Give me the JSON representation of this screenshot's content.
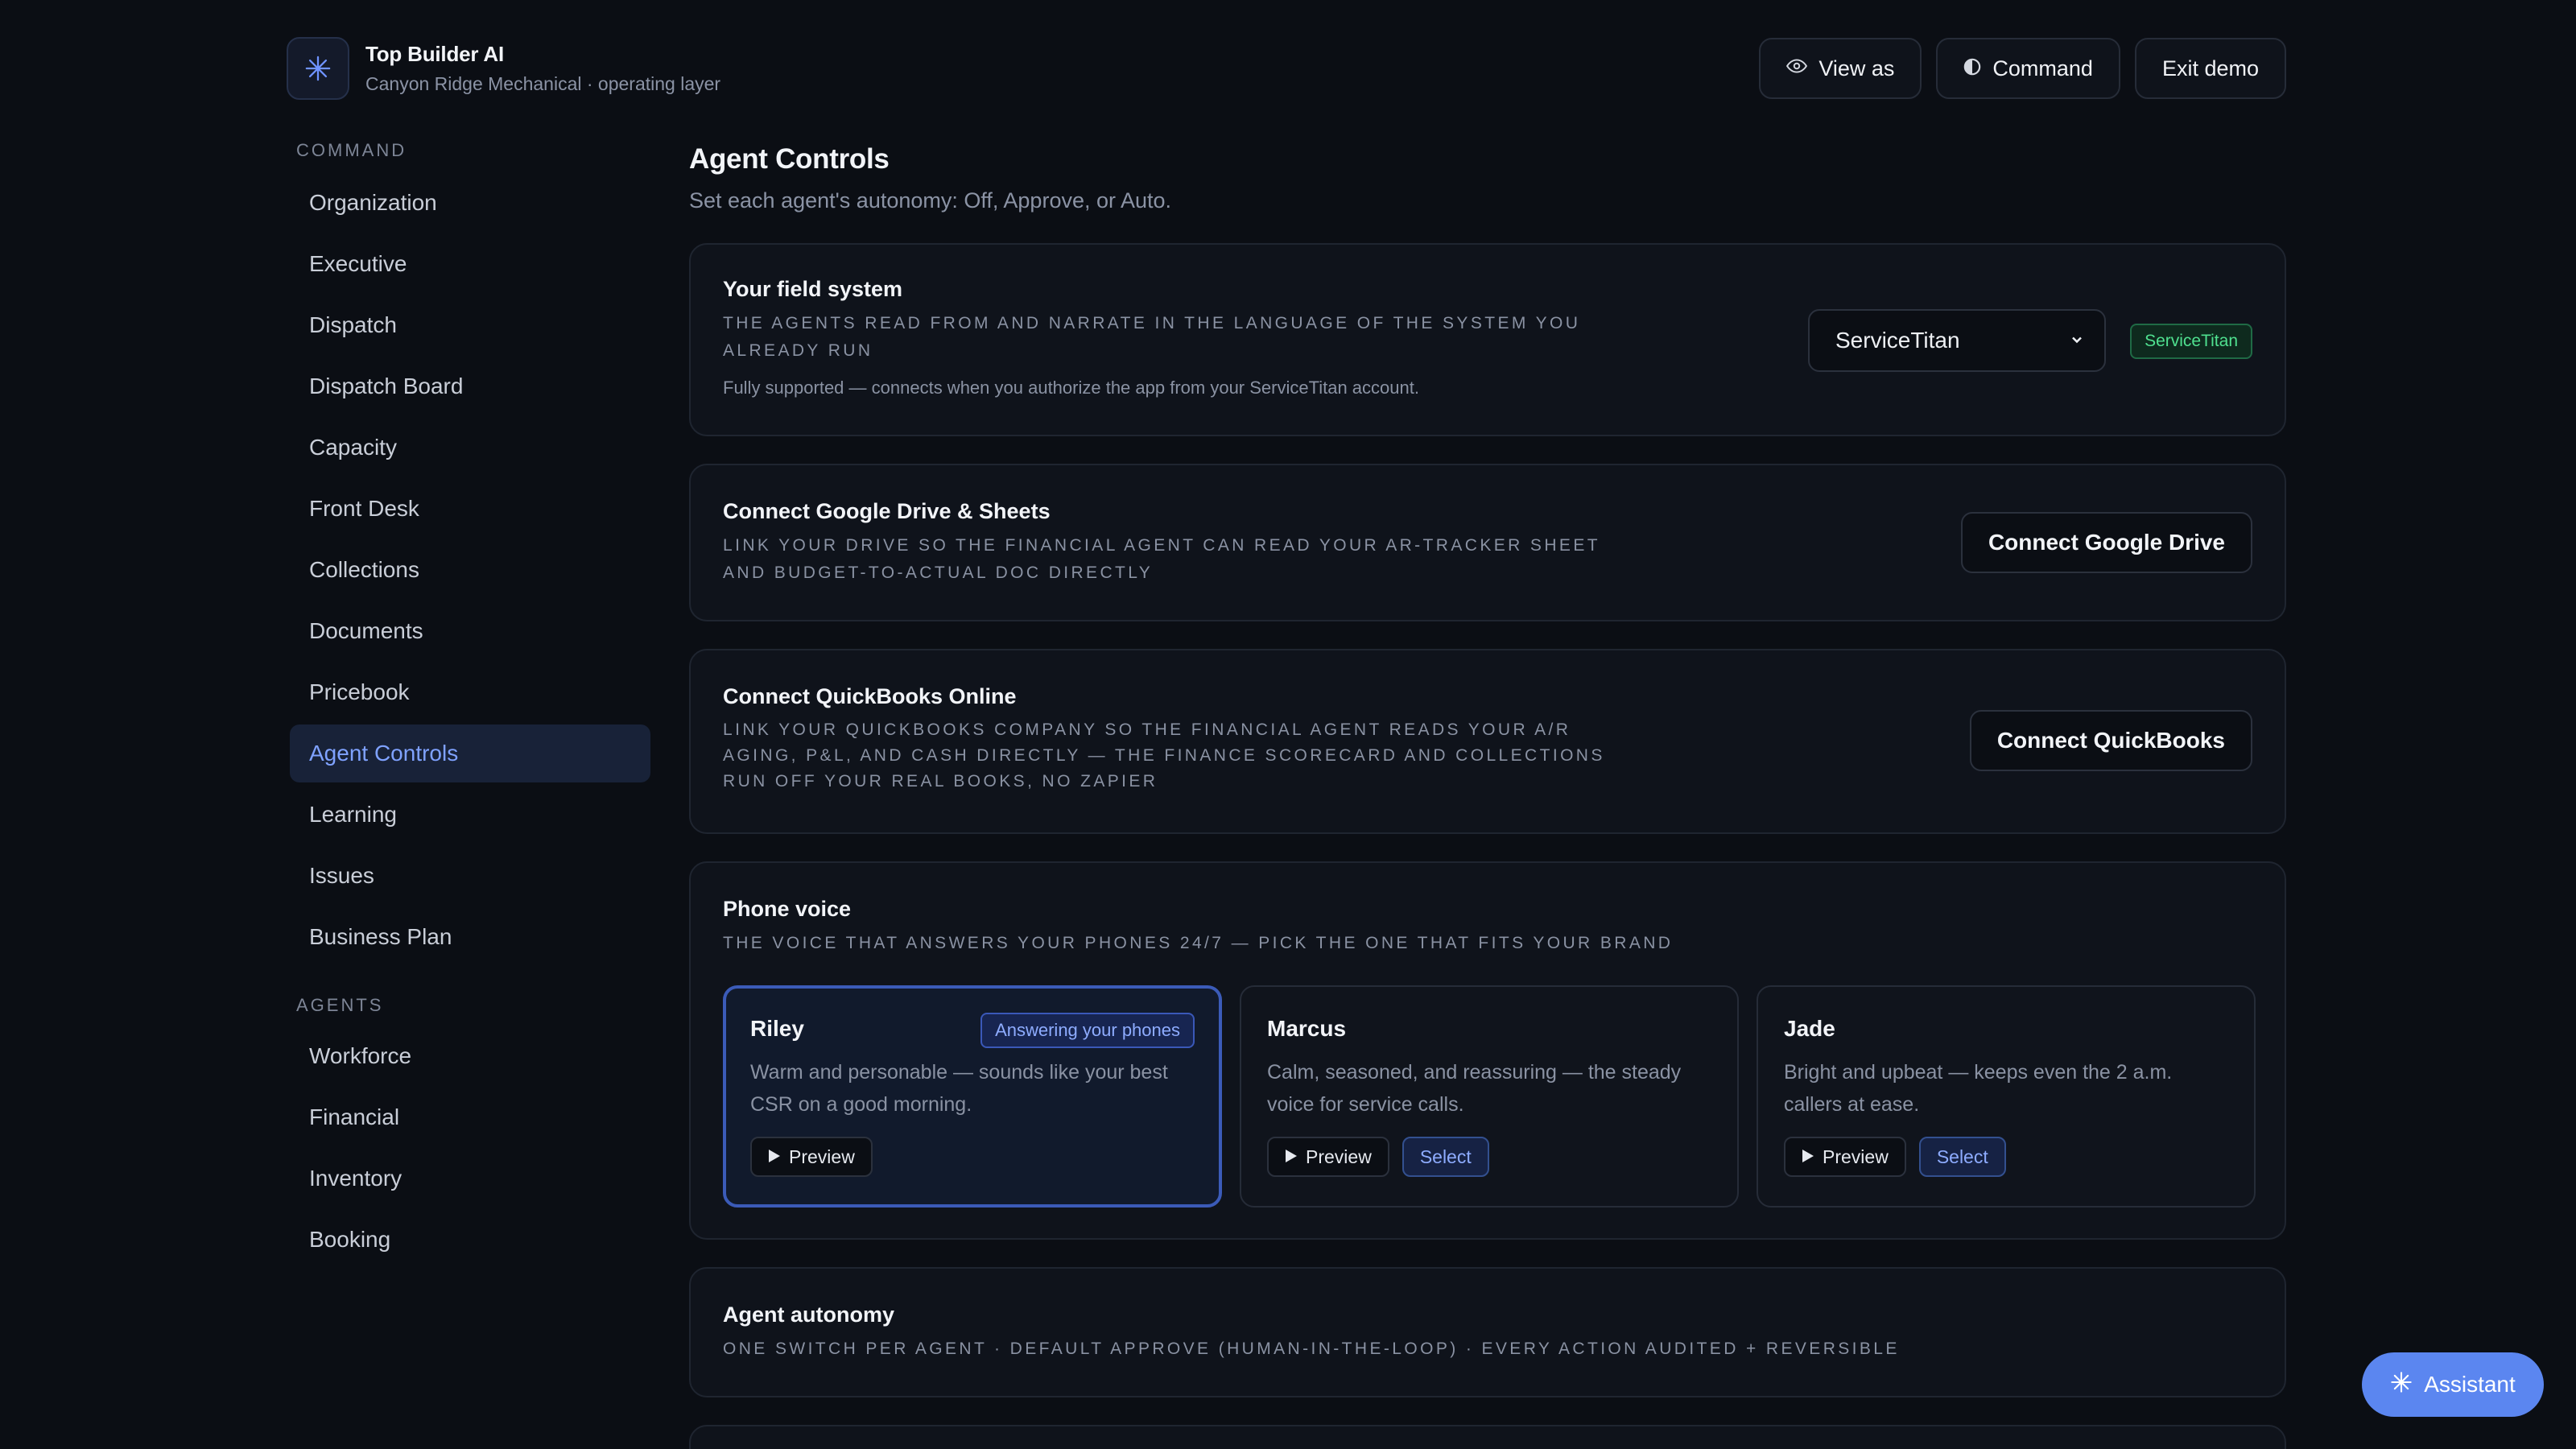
{
  "brand": {
    "title": "Top Builder AI",
    "subtitle": "Canyon Ridge Mechanical · operating layer",
    "logo_icon": "sparkle-icon"
  },
  "header_actions": {
    "view_as": "View as",
    "command": "Command",
    "exit_demo": "Exit demo"
  },
  "sidebar": {
    "command_heading": "COMMAND",
    "command_items": [
      {
        "label": "Organization"
      },
      {
        "label": "Executive"
      },
      {
        "label": "Dispatch"
      },
      {
        "label": "Dispatch Board"
      },
      {
        "label": "Capacity"
      },
      {
        "label": "Front Desk"
      },
      {
        "label": "Collections"
      },
      {
        "label": "Documents"
      },
      {
        "label": "Pricebook"
      },
      {
        "label": "Agent Controls",
        "active": true
      },
      {
        "label": "Learning"
      },
      {
        "label": "Issues"
      },
      {
        "label": "Business Plan"
      }
    ],
    "agents_heading": "AGENTS",
    "agent_items": [
      {
        "label": "Workforce"
      },
      {
        "label": "Financial"
      },
      {
        "label": "Inventory"
      },
      {
        "label": "Booking"
      }
    ]
  },
  "main": {
    "title": "Agent Controls",
    "subtitle": "Set each agent's autonomy: Off, Approve, or Auto."
  },
  "field_system": {
    "title": "Your field system",
    "caps": "The agents read from and narrate in the language of the system you already run",
    "note": "Fully supported — connects when you authorize the app from your ServiceTitan account.",
    "selected_value": "ServiceTitan",
    "badge": "ServiceTitan"
  },
  "google_drive": {
    "title": "Connect Google Drive & Sheets",
    "caps": "Link your Drive so the financial agent can read your AR-tracker sheet and budget-to-actual doc directly",
    "button": "Connect Google Drive"
  },
  "quickbooks": {
    "title": "Connect QuickBooks Online",
    "caps": "Link your QuickBooks company so the financial agent reads your A/R aging, P&L, and cash directly — the finance scorecard and collections run off your real books, no Zapier",
    "button": "Connect QuickBooks"
  },
  "phone_voice": {
    "title": "Phone voice",
    "caps": "The voice that answers your phones 24/7 — pick the one that fits your brand",
    "voices": [
      {
        "name": "Riley",
        "desc": "Warm and personable — sounds like your best CSR on a good morning.",
        "badge": "Answering your phones",
        "preview": "Preview",
        "selected": true
      },
      {
        "name": "Marcus",
        "desc": "Calm, seasoned, and reassuring — the steady voice for service calls.",
        "preview": "Preview",
        "select": "Select"
      },
      {
        "name": "Jade",
        "desc": "Bright and upbeat — keeps even the 2 a.m. callers at ease.",
        "preview": "Preview",
        "select": "Select"
      }
    ]
  },
  "autonomy": {
    "title": "Agent autonomy",
    "caps": "One switch per agent · Default Approve (human-in-the-loop) · Every action audited + reversible"
  },
  "assistant": {
    "label": "Assistant"
  },
  "colors": {
    "background": "#0b0e14",
    "accent": "#5b86f0",
    "active_nav": "#7fa2ff",
    "success_badge": "#4fe08f"
  }
}
